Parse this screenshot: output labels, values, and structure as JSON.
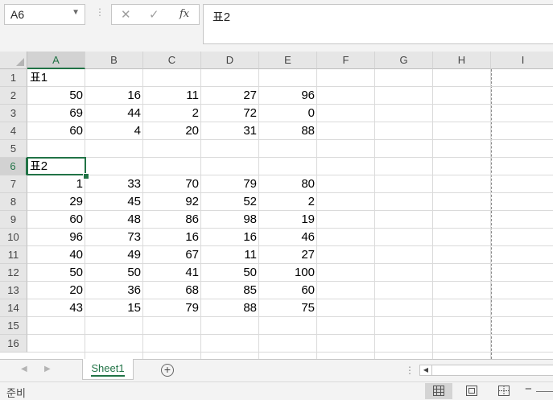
{
  "formula_bar": {
    "name_box": "A6",
    "dropdown_icon": "chevron-down-icon",
    "cancel_icon": "cancel-x-icon",
    "enter_icon": "checkmark-icon",
    "fx_label": "fx",
    "formula": "표2"
  },
  "columns": [
    "A",
    "B",
    "C",
    "D",
    "E",
    "F",
    "G",
    "H",
    "I"
  ],
  "rows": [
    "1",
    "2",
    "3",
    "4",
    "5",
    "6",
    "7",
    "8",
    "9",
    "10",
    "11",
    "12",
    "13",
    "14",
    "15",
    "16"
  ],
  "selected_cell": "A6",
  "cells": {
    "r1": {
      "A": "표1"
    },
    "r2": {
      "A": "50",
      "B": "16",
      "C": "11",
      "D": "27",
      "E": "96"
    },
    "r3": {
      "A": "69",
      "B": "44",
      "C": "2",
      "D": "72",
      "E": "0"
    },
    "r4": {
      "A": "60",
      "B": "4",
      "C": "20",
      "D": "31",
      "E": "88"
    },
    "r6": {
      "A": "표2"
    },
    "r7": {
      "A": "1",
      "B": "33",
      "C": "70",
      "D": "79",
      "E": "80"
    },
    "r8": {
      "A": "29",
      "B": "45",
      "C": "92",
      "D": "52",
      "E": "2"
    },
    "r9": {
      "A": "60",
      "B": "48",
      "C": "86",
      "D": "98",
      "E": "19"
    },
    "r10": {
      "A": "96",
      "B": "73",
      "C": "16",
      "D": "16",
      "E": "46"
    },
    "r11": {
      "A": "40",
      "B": "49",
      "C": "67",
      "D": "11",
      "E": "27"
    },
    "r12": {
      "A": "50",
      "B": "50",
      "C": "41",
      "D": "50",
      "E": "100"
    },
    "r13": {
      "A": "20",
      "B": "36",
      "C": "68",
      "D": "85",
      "E": "60"
    },
    "r14": {
      "A": "43",
      "B": "15",
      "C": "79",
      "D": "88",
      "E": "75"
    }
  },
  "sheet_tabs": {
    "active": "Sheet1",
    "add_icon": "plus-circle-icon"
  },
  "status_bar": {
    "ready_text": "준비",
    "zoom_out": "−",
    "views": [
      "normal-view-icon",
      "page-layout-icon",
      "page-break-preview-icon"
    ],
    "active_view": "normal-view-icon"
  },
  "colors": {
    "accent": "#217346",
    "grid": "#dadada",
    "header_bg": "#e6e6e6",
    "chrome_bg": "#f3f3f3"
  }
}
